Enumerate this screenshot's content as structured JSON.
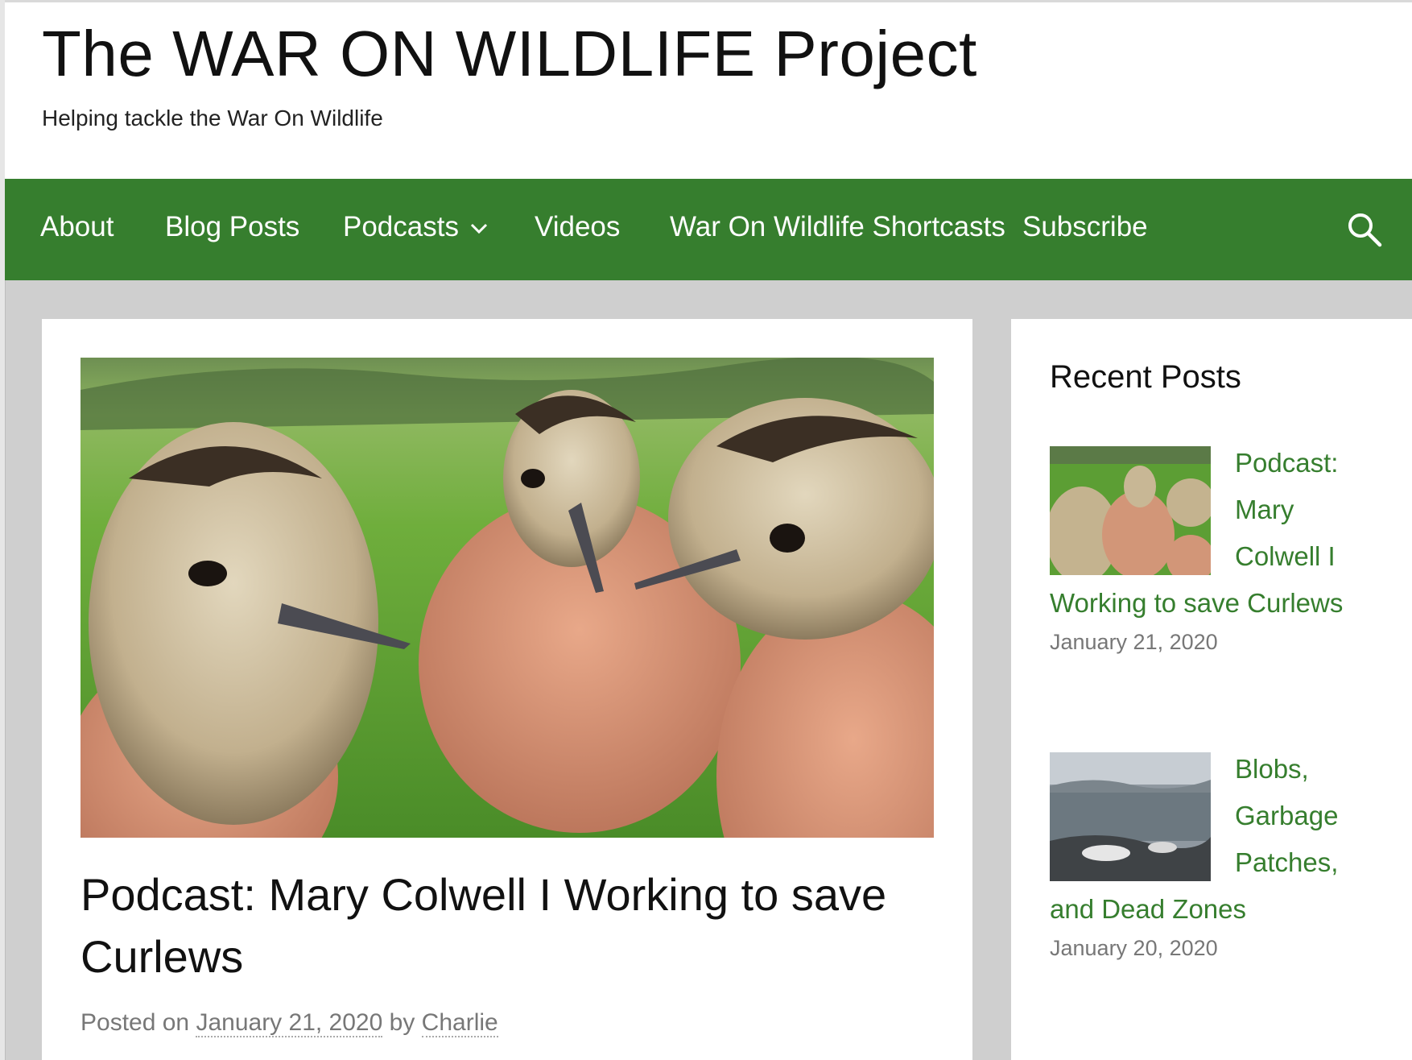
{
  "site": {
    "title": "The WAR ON WILDLIFE Project",
    "tagline": "Helping tackle the War On Wildlife"
  },
  "nav": {
    "items": [
      {
        "label": "About"
      },
      {
        "label": "Blog Posts"
      },
      {
        "label": "Podcasts",
        "icon": "chevron-down-icon"
      },
      {
        "label": "Videos"
      },
      {
        "label": "War On Wildlife Shortcasts"
      },
      {
        "label": "Subscribe"
      }
    ],
    "search_icon": "search-icon"
  },
  "post": {
    "image_alt": "Three curlew chicks held in hands in front of a green field",
    "title": "Podcast: Mary Colwell I Working to save Curlews",
    "meta": {
      "posted_on": "Posted on",
      "date": "January 21, 2020",
      "by": "by",
      "author": "Charlie"
    }
  },
  "sidebar": {
    "widget_title": "Recent Posts",
    "recent_posts": [
      {
        "title": "Podcast: Mary Colwell I Working to save Curlews",
        "date": "January 21, 2020"
      },
      {
        "title": "Blobs, Garbage Patches, and Dead Zones",
        "date": "January 20, 2020"
      }
    ]
  },
  "colors": {
    "accent": "#367e2e",
    "background": "#cfcfcf",
    "meta_text": "#777777"
  }
}
